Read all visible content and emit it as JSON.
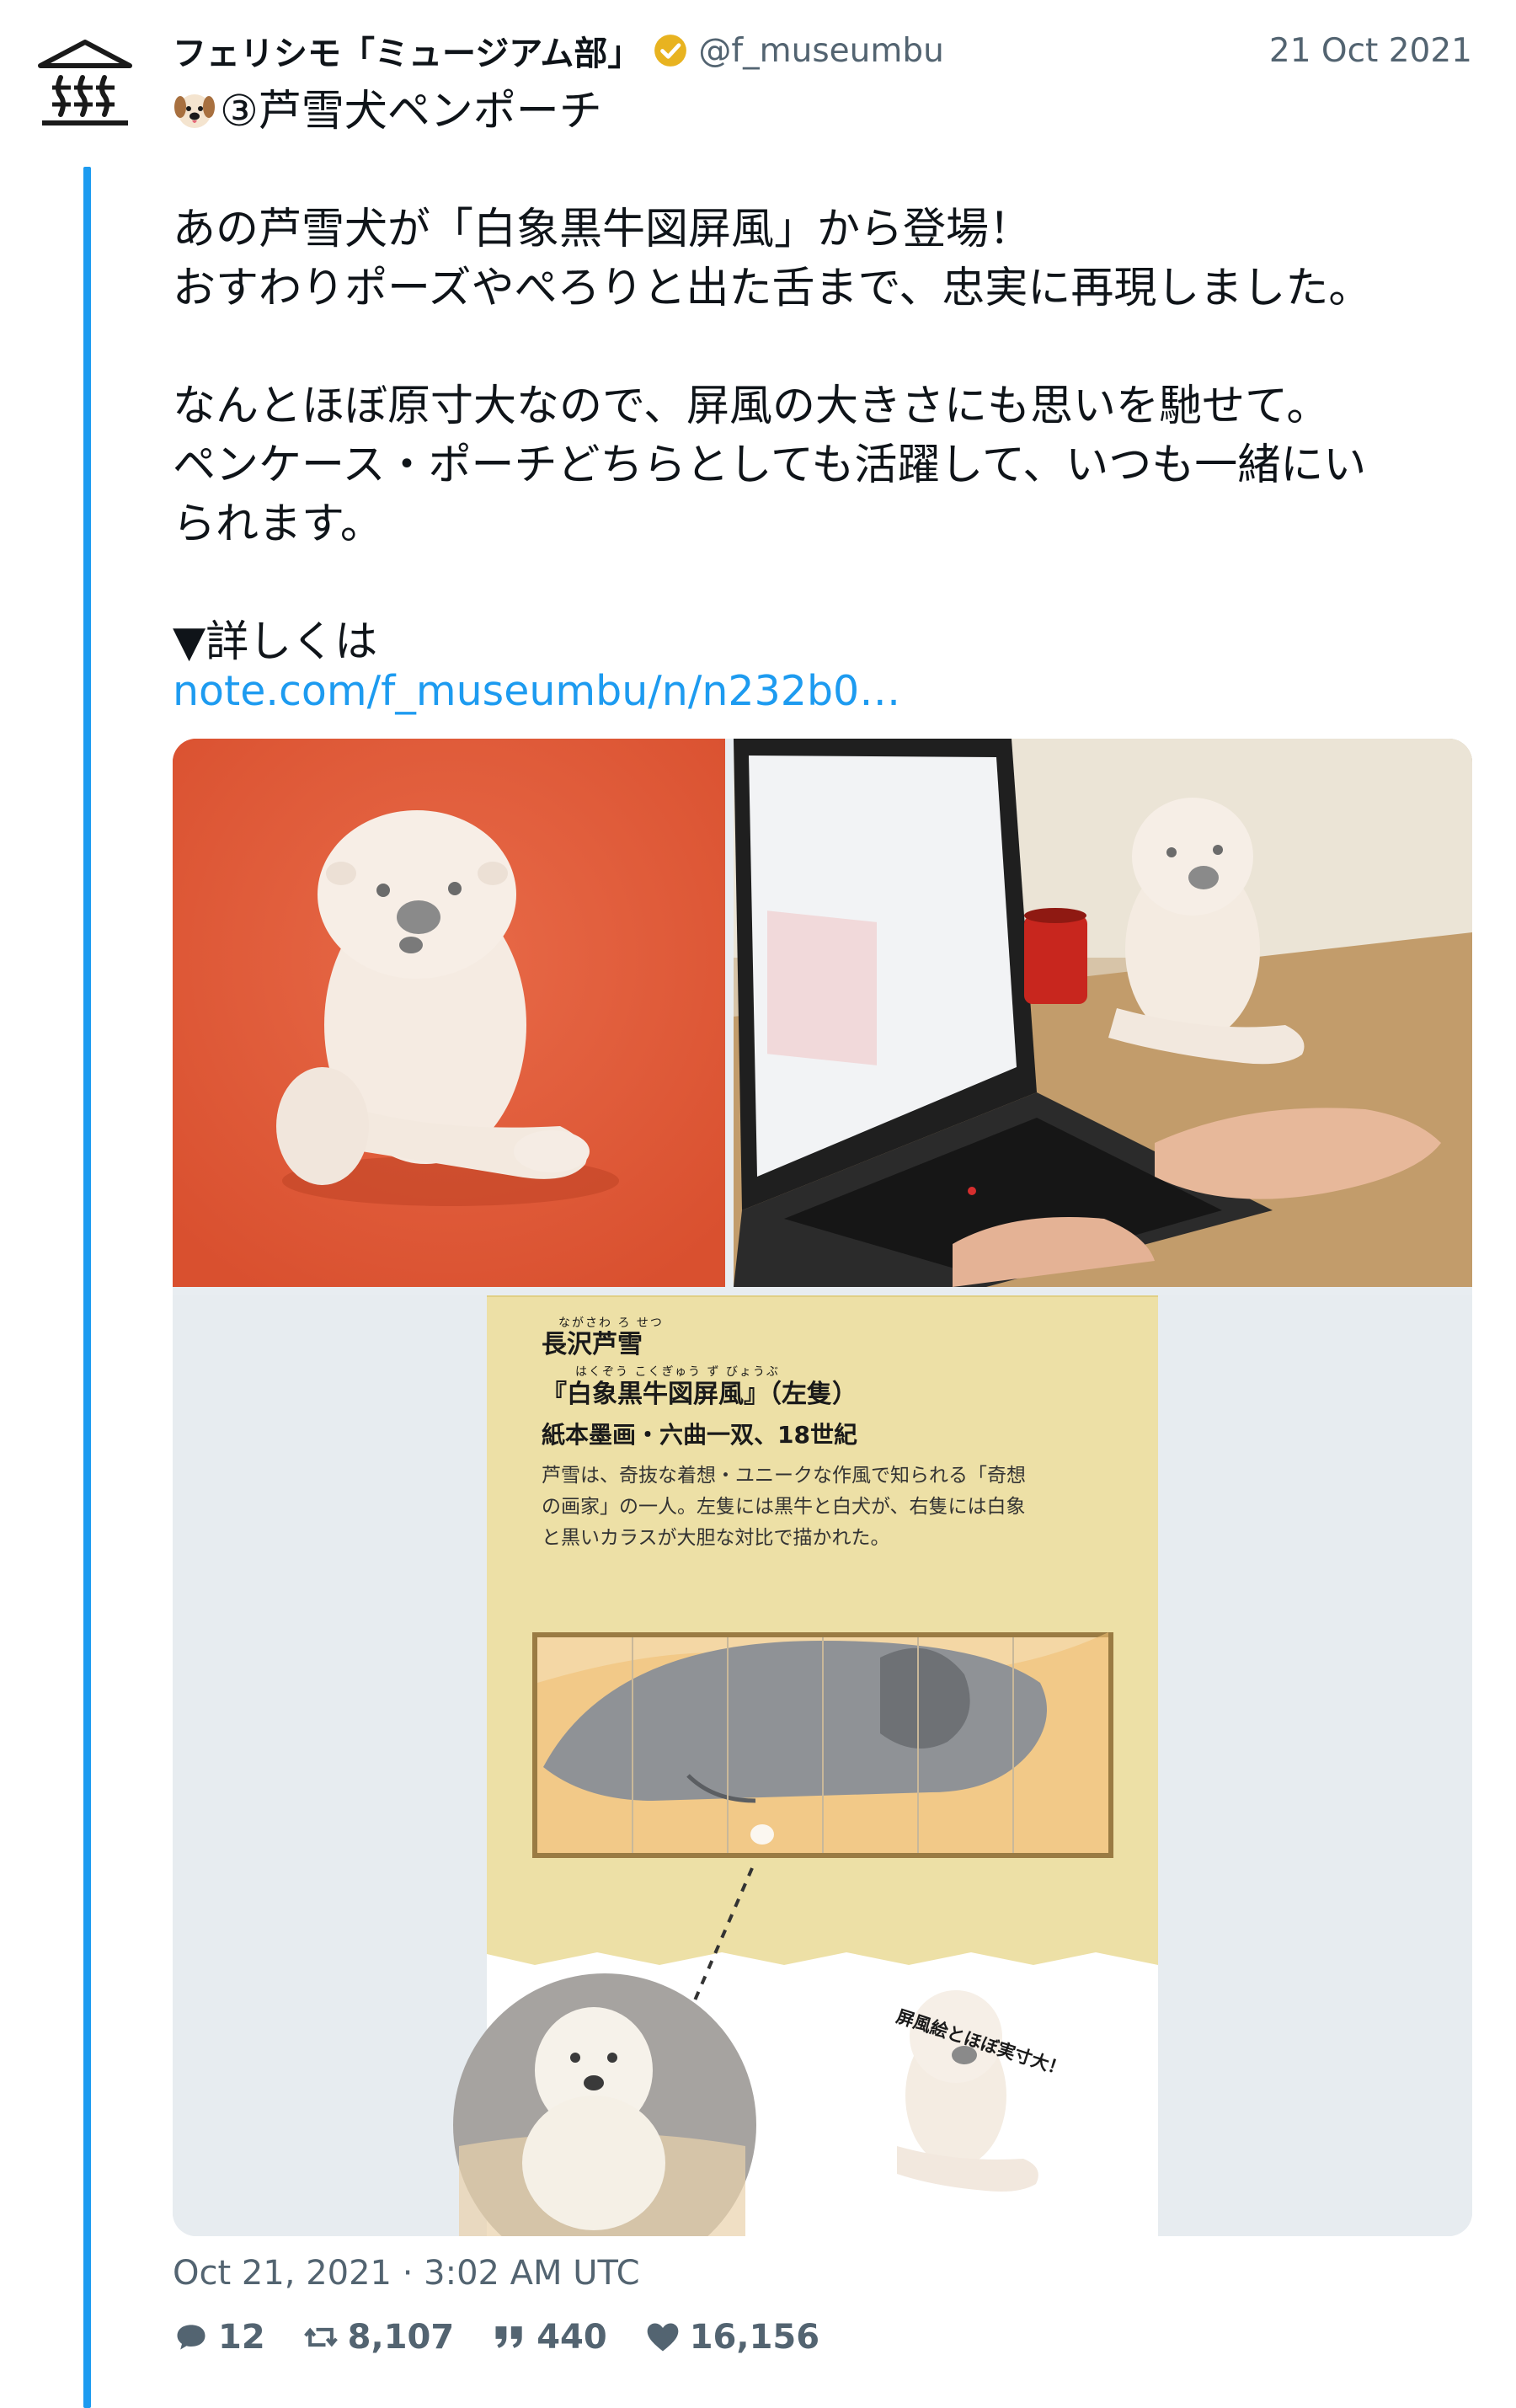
{
  "author": {
    "display_name": "フェリシモ「ミュージアム部」",
    "handle": "@f_museumbu",
    "verified": true
  },
  "date_short": "21 Oct 2021",
  "tweet": {
    "text": "③芦雪犬ペンポーチ\n\nあの芦雪犬が「白象黒牛図屏風」から登場！\nおすわりポーズやぺろりと出た舌まで、忠実に再現しました。\n\nなんとほぼ原寸大なので、屏風の大きさにも思いを馳せて。\nペンケース・ポーチどちらとしても活躍して、いつも一緒にい\nられます。\n\n▼詳しくは",
    "link": "note.com/f_museumbu/n/n232b0…"
  },
  "media": {
    "photo_1": "plush-dog-on-orange",
    "photo_2": "plush-dog-by-laptop",
    "photo_3": {
      "ruby_artist": "ながさわ ろ せつ",
      "artist": "長沢芦雪",
      "ruby_title": "はくぞう こくぎゅう ず びょうぶ",
      "title": "『白象黒牛図屏風』（左隻）",
      "medium": "紙本墨画・六曲一双、18世紀",
      "desc_lines": [
        "芦雪は、奇抜な着想・ユニークな作風で知られる「奇想",
        "の画家」の一人。左隻には黒牛と白犬が、右隻には白象",
        "と黒いカラスが大胆な対比で描かれた。"
      ],
      "callout": "屏風絵とほぼ実寸大！"
    }
  },
  "timestamp": "Oct 21, 2021 · 3:02 AM UTC",
  "stats": {
    "replies": "12",
    "retweets": "8,107",
    "quotes": "440",
    "likes": "16,156"
  },
  "colors": {
    "link": "#1d9bf0",
    "thread": "#1d9bf0",
    "verified": "#e8b320",
    "muted": "#536471"
  }
}
